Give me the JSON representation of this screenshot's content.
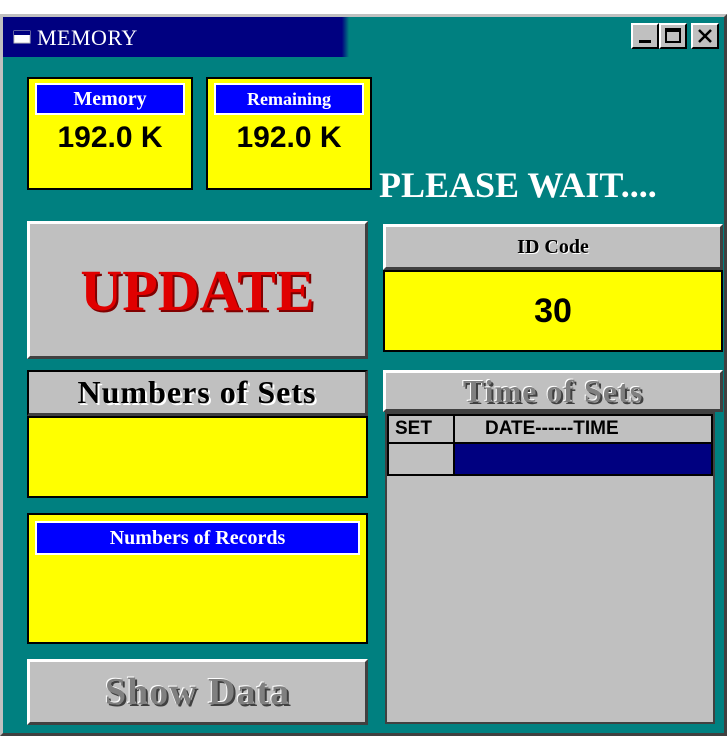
{
  "window": {
    "title": "MEMORY",
    "icons": {
      "app": "app-icon",
      "minimize": "minimize-icon",
      "maximize": "maximize-icon",
      "close": "close-icon"
    }
  },
  "memory": {
    "label": "Memory",
    "value": "192.0 K"
  },
  "remaining": {
    "label": "Remaining",
    "value": "192.0 K"
  },
  "status": "PLEASE WAIT....",
  "update_button": "UPDATE",
  "id_code": {
    "label": "ID Code",
    "value": "30"
  },
  "sets": {
    "label": "Numbers of Sets",
    "value": ""
  },
  "records": {
    "label": "Numbers of Records",
    "value": ""
  },
  "time_of_sets": {
    "label": "Time of Sets",
    "columns": [
      "SET",
      "DATE------TIME"
    ],
    "rows": [
      [
        "",
        ""
      ]
    ]
  },
  "show_data_button": "Show Data",
  "colors": {
    "background": "#008080",
    "panel": "#ffff00",
    "header": "#0000ff",
    "accent": "#e00000",
    "selection": "#000080"
  }
}
